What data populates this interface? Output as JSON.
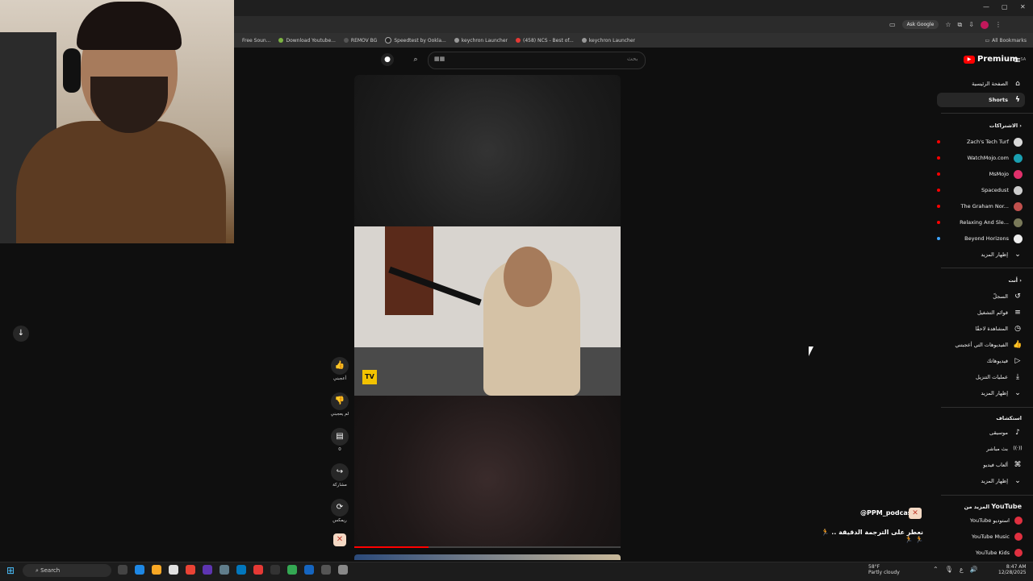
{
  "browser": {
    "bookmarks": [
      "Free Soun...",
      "Download Youtube...",
      "REMOV BG",
      "Speedtest by Ookla...",
      "keychron Launcher",
      "(458) NCS - Best of...",
      "keychron Launcher"
    ],
    "all_bookmarks": "All Bookmarks",
    "ask_google": "Ask Google",
    "window_controls": [
      "—",
      "▢",
      "✕"
    ]
  },
  "header": {
    "search_placeholder": "بحث",
    "search_value": "▦▦",
    "logo_text": "Premium",
    "logo_region": "SA"
  },
  "sidebar": {
    "nav": [
      {
        "label": "الصفحة الرئيسية",
        "icon": "home-icon",
        "glyph": "⌂"
      },
      {
        "label": "Shorts",
        "icon": "shorts-icon",
        "glyph": "ϟ"
      }
    ],
    "subscriptions_title": "الاشتراكات",
    "subscriptions": [
      {
        "label": "Zach's Tech Turf",
        "color": "#d8d8d8"
      },
      {
        "label": "WatchMojo.com",
        "color": "#1a9fb0"
      },
      {
        "label": "MsMojo",
        "color": "#e0306b"
      },
      {
        "label": "Spacedust",
        "color": "#cccccc"
      },
      {
        "label": "The Graham Nor...",
        "color": "#c0504d"
      },
      {
        "label": "Relaxing And Sle...",
        "color": "#7a7a5a"
      },
      {
        "label": "Beyond Horizons",
        "color": "#eeeeee"
      }
    ],
    "show_more": "إظهار المزيد",
    "you_title": "أنت",
    "you_items": [
      {
        "label": "السجلّ",
        "glyph": "↺"
      },
      {
        "label": "قوائم التشغيل",
        "glyph": "≡"
      },
      {
        "label": "المشاهدة لاحقًا",
        "glyph": "◷"
      },
      {
        "label": "الفيديوهات التي أعجبتني",
        "glyph": "👍"
      },
      {
        "label": "فيديوهاتك",
        "glyph": "▷"
      },
      {
        "label": "عمليات التنزيل",
        "glyph": "⤓"
      }
    ],
    "explore_title": "استكشاف",
    "explore_items": [
      {
        "label": "موسيقى",
        "glyph": "♪"
      },
      {
        "label": "بث مباشر",
        "glyph": "((·))"
      },
      {
        "label": "ألعاب فيديو",
        "glyph": "⌘"
      }
    ],
    "more_title": "المزيد من",
    "more_brand": "YouTube",
    "more_items": [
      "YouTube استوديو",
      "YouTube Music",
      "YouTube Kids"
    ]
  },
  "short": {
    "actions": [
      {
        "name": "like",
        "glyph": "👍",
        "label": "أعجبني"
      },
      {
        "name": "dislike",
        "glyph": "👎",
        "label": "لم يعجبني"
      },
      {
        "name": "comments",
        "glyph": "▤",
        "label": "0"
      },
      {
        "name": "share",
        "glyph": "↪",
        "label": "مشاركة"
      },
      {
        "name": "remix",
        "glyph": "⟳",
        "label": "ريمكس"
      }
    ],
    "sticker_text": "TV",
    "channel": "@PPM_podcast",
    "title": "نعطر على الترجمة الدقيقة .. 🏃 🏃 🏃",
    "progress": 0.28
  },
  "taskbar": {
    "search": "Search",
    "weather_temp": "58°F",
    "weather_desc": "Partly cloudy",
    "time": "8:47 AM",
    "date": "12/28/2025",
    "lang": "ع"
  }
}
